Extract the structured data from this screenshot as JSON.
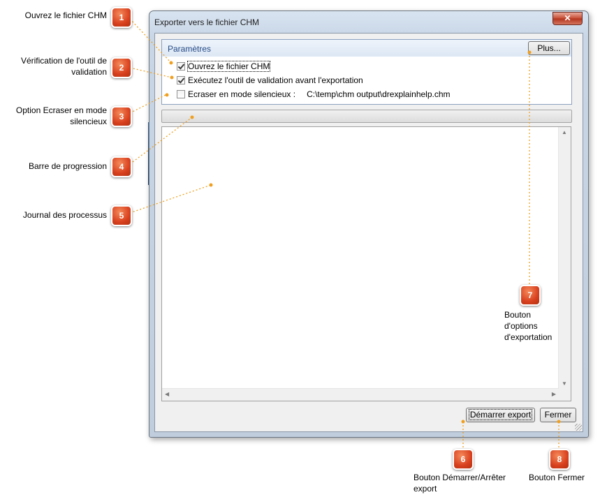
{
  "dialog": {
    "title": "Exporter vers le fichier CHM",
    "close_symbol": "✕",
    "settings": {
      "group_title": "Paramètres",
      "more_button": "Plus...",
      "open_chm": {
        "label": "Ouvrez le fichier CHM",
        "checked": true
      },
      "run_validation": {
        "label": "Exécutez l'outil de validation avant l'exportation",
        "checked": true
      },
      "overwrite_silent": {
        "label": "Ecraser en mode silencieux :",
        "checked": false
      },
      "output_path": "C:\\temp\\chm output\\drexplainhelp.chm"
    },
    "progress_percent": 0,
    "log_lines": [],
    "start_export_button": "Démarrer export",
    "close_button": "Fermer"
  },
  "callouts": [
    {
      "number": "1",
      "text": "Ouvrez le fichier CHM"
    },
    {
      "number": "2",
      "text": "Vérification de l'outil de validation"
    },
    {
      "number": "3",
      "text": "Option Ecraser en mode silencieux"
    },
    {
      "number": "4",
      "text": "Barre de progression"
    },
    {
      "number": "5",
      "text": "Journal des processus"
    },
    {
      "number": "6",
      "text": "Bouton Démarrer/Arrêter export"
    },
    {
      "number": "7",
      "text": "Bouton d'options d'exportation"
    },
    {
      "number": "8",
      "text": "Bouton Fermer"
    }
  ],
  "colors": {
    "badge": "#e0501f",
    "leader": "#f0a020",
    "group_title": "#254a86"
  }
}
